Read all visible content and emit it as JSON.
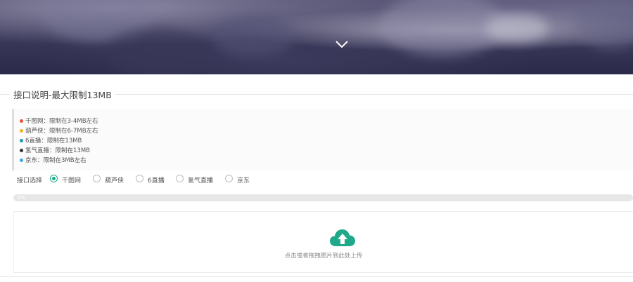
{
  "section": {
    "title": "接口说明-最大限制13MB"
  },
  "notes": [
    {
      "text": "千图网：限制在3-4MB左右",
      "color": "#e8553b"
    },
    {
      "text": "葫芦侠：限制在6-7MB左右",
      "color": "#f0b323"
    },
    {
      "text": "6直播：限制在13MB",
      "color": "#1a9db0"
    },
    {
      "text": "氢气直播：限制在13MB",
      "color": "#333333"
    },
    {
      "text": "京东：限制在3MB左右",
      "color": "#3ba5e0"
    }
  ],
  "interface": {
    "label": "接口选择",
    "options": [
      {
        "label": "千图网",
        "checked": true
      },
      {
        "label": "葫芦侠",
        "checked": false
      },
      {
        "label": "6直播",
        "checked": false
      },
      {
        "label": "氢气直播",
        "checked": false
      },
      {
        "label": "京东",
        "checked": false
      }
    ]
  },
  "progress": {
    "text": "0%",
    "value": 0
  },
  "upload": {
    "text": "点击或者拖拽图片到此处上传",
    "icon": "cloud-upload-icon"
  },
  "colors": {
    "accent": "#1eaa8a"
  }
}
